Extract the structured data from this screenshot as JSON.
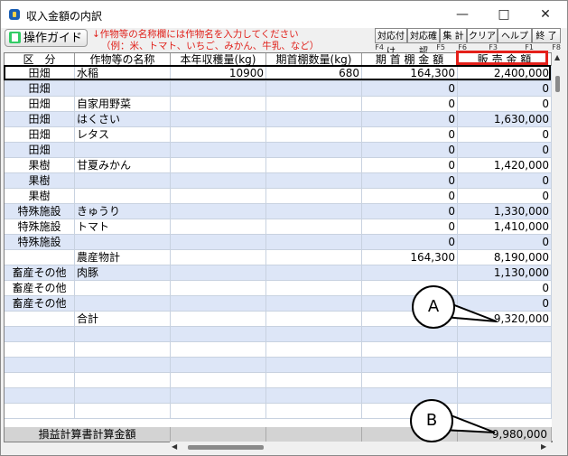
{
  "window": {
    "title": "収入金額の内訳",
    "minimize": "—",
    "maximize": "□",
    "close": "✕"
  },
  "toolbar": {
    "guide_label": "操作ガイド",
    "notice_line1": "↓作物等の名称欄には作物名を入力してください",
    "notice_line2": "（例：米、トマト、いちご、みかん、牛乳、など）",
    "fkeys": [
      {
        "label": "対応付け",
        "key": "F4"
      },
      {
        "label": "対応確認",
        "key": "F5"
      },
      {
        "label": "集 計",
        "key": "F6"
      },
      {
        "label": "クリア",
        "key": "F3"
      },
      {
        "label": "ヘルプ",
        "key": "F1"
      },
      {
        "label": "終 了",
        "key": "F8"
      }
    ]
  },
  "columns": [
    "区　分",
    "作物等の名称",
    "本年収穫量(kg)",
    "期首棚数量(kg)",
    "期 首 棚 金 額",
    "販 売 金 額"
  ],
  "rows": [
    [
      "田畑",
      "水稲",
      "10900",
      "680",
      "164,300",
      "2,400,000"
    ],
    [
      "田畑",
      "",
      "",
      "",
      "0",
      "0"
    ],
    [
      "田畑",
      "自家用野菜",
      "",
      "",
      "0",
      "0"
    ],
    [
      "田畑",
      "はくさい",
      "",
      "",
      "0",
      "1,630,000"
    ],
    [
      "田畑",
      "レタス",
      "",
      "",
      "0",
      "0"
    ],
    [
      "田畑",
      "",
      "",
      "",
      "0",
      "0"
    ],
    [
      "果樹",
      "甘夏みかん",
      "",
      "",
      "0",
      "1,420,000"
    ],
    [
      "果樹",
      "",
      "",
      "",
      "0",
      "0"
    ],
    [
      "果樹",
      "",
      "",
      "",
      "0",
      "0"
    ],
    [
      "特殊施設",
      "きゅうり",
      "",
      "",
      "0",
      "1,330,000"
    ],
    [
      "特殊施設",
      "トマト",
      "",
      "",
      "0",
      "1,410,000"
    ],
    [
      "特殊施設",
      "",
      "",
      "",
      "0",
      "0"
    ],
    [
      "",
      "農産物計",
      "",
      "",
      "164,300",
      "8,190,000"
    ],
    [
      "畜産その他",
      "肉豚",
      "",
      "",
      "",
      "1,130,000"
    ],
    [
      "畜産その他",
      "",
      "",
      "",
      "",
      "0"
    ],
    [
      "畜産その他",
      "",
      "",
      "",
      "",
      "0"
    ],
    [
      "",
      "合計",
      "",
      "",
      "",
      "9,320,000"
    ],
    [
      "",
      "",
      "",
      "",
      "",
      ""
    ],
    [
      "",
      "",
      "",
      "",
      "",
      ""
    ],
    [
      "",
      "",
      "",
      "",
      "",
      ""
    ],
    [
      "",
      "",
      "",
      "",
      "",
      ""
    ],
    [
      "",
      "",
      "",
      "",
      "",
      ""
    ],
    [
      "",
      "",
      "",
      "",
      "",
      ""
    ]
  ],
  "footer": {
    "label": "損益計算書計算金額",
    "value": "9,980,000"
  },
  "callouts": {
    "a": "A",
    "b": "B"
  },
  "colors": {
    "blue_row": "#dde6f7",
    "white_row": "#ffffff",
    "highlight": "#e4201a"
  }
}
